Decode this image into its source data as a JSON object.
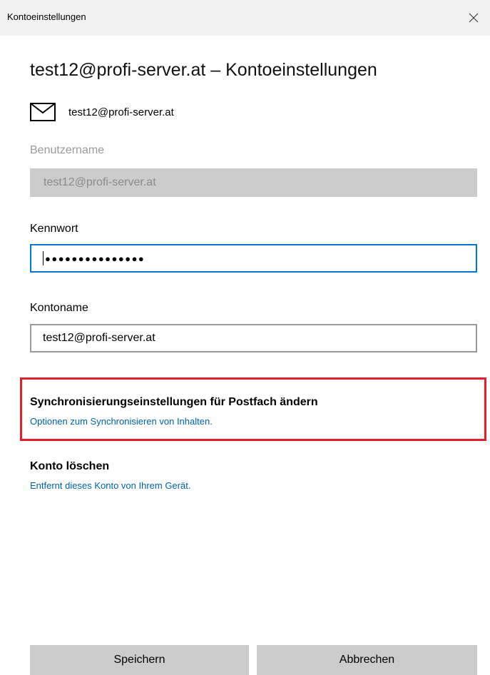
{
  "window": {
    "title": "Kontoeinstellungen"
  },
  "header": {
    "heading": "test12@profi-server.at – Kontoeinstellungen",
    "account_email": "test12@profi-server.at"
  },
  "form": {
    "username_label": "Benutzername",
    "username_value": "test12@profi-server.at",
    "password_label": "Kennwort",
    "password_masked": "●●●●●●●●●●●●●●●",
    "account_name_label": "Kontoname",
    "account_name_value": "test12@profi-server.at"
  },
  "actions": {
    "sync_title": "Synchronisierungseinstellungen für Postfach ändern",
    "sync_link": "Optionen zum Synchronisieren von Inhalten.",
    "delete_title": "Konto löschen",
    "delete_link": "Entfernt dieses Konto von Ihrem Gerät."
  },
  "buttons": {
    "save": "Speichern",
    "cancel": "Abbrechen"
  },
  "icons": {
    "close": "close-icon",
    "mail": "mail-icon"
  },
  "colors": {
    "accent": "#0078d7",
    "link": "#0063b1",
    "highlight": "#e51f2a",
    "titlebar": "#f2f2f2",
    "disabled_field": "#cccccc"
  }
}
